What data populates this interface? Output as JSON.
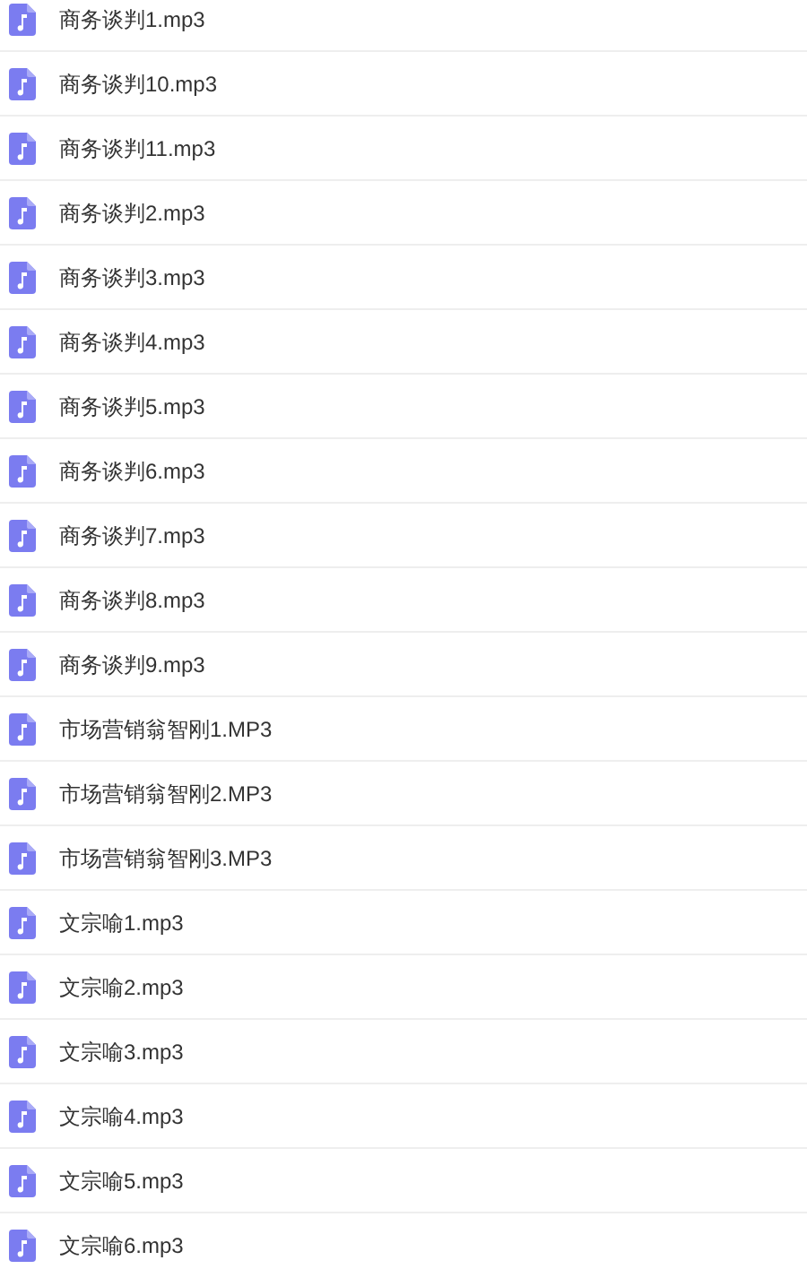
{
  "files": [
    {
      "name": "商务谈判1.mp3"
    },
    {
      "name": "商务谈判10.mp3"
    },
    {
      "name": "商务谈判11.mp3"
    },
    {
      "name": "商务谈判2.mp3"
    },
    {
      "name": "商务谈判3.mp3"
    },
    {
      "name": "商务谈判4.mp3"
    },
    {
      "name": "商务谈判5.mp3"
    },
    {
      "name": "商务谈判6.mp3"
    },
    {
      "name": "商务谈判7.mp3"
    },
    {
      "name": "商务谈判8.mp3"
    },
    {
      "name": "商务谈判9.mp3"
    },
    {
      "name": "市场营销翁智刚1.MP3"
    },
    {
      "name": "市场营销翁智刚2.MP3"
    },
    {
      "name": "市场营销翁智刚3.MP3"
    },
    {
      "name": "文宗喻1.mp3"
    },
    {
      "name": "文宗喻2.mp3"
    },
    {
      "name": "文宗喻3.mp3"
    },
    {
      "name": "文宗喻4.mp3"
    },
    {
      "name": "文宗喻5.mp3"
    },
    {
      "name": "文宗喻6.mp3"
    }
  ]
}
